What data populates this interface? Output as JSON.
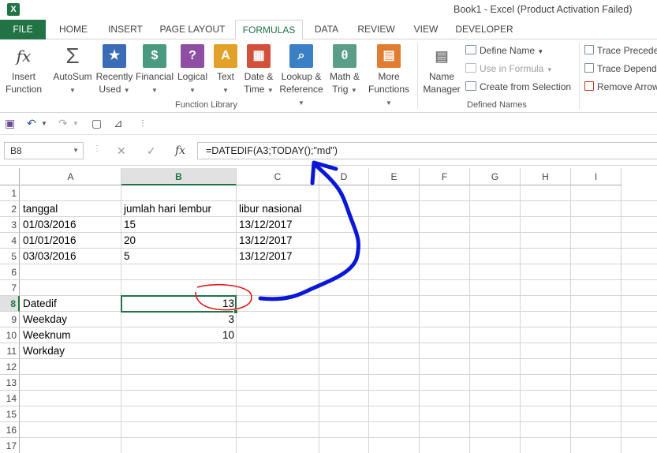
{
  "window": {
    "title": "Book1 - Excel (Product Activation Failed)",
    "app_icon": "X"
  },
  "tabs": [
    {
      "label": "FILE"
    },
    {
      "label": "HOME"
    },
    {
      "label": "INSERT"
    },
    {
      "label": "PAGE LAYOUT"
    },
    {
      "label": "FORMULAS"
    },
    {
      "label": "DATA"
    },
    {
      "label": "REVIEW"
    },
    {
      "label": "VIEW"
    },
    {
      "label": "DEVELOPER"
    }
  ],
  "ribbon": {
    "function_library": {
      "group_label": "Function Library",
      "buttons": [
        {
          "line1": "Insert",
          "line2": "Function",
          "icon": "fx"
        },
        {
          "line1": "AutoSum",
          "line2": "",
          "icon": "Σ"
        },
        {
          "line1": "Recently",
          "line2": "Used",
          "icon": "★"
        },
        {
          "line1": "Financial",
          "line2": "",
          "icon": "$"
        },
        {
          "line1": "Logical",
          "line2": "",
          "icon": "?"
        },
        {
          "line1": "Text",
          "line2": "",
          "icon": "A"
        },
        {
          "line1": "Date &",
          "line2": "Time",
          "icon": "▦"
        },
        {
          "line1": "Lookup &",
          "line2": "Reference",
          "icon": "⌕"
        },
        {
          "line1": "Math &",
          "line2": "Trig",
          "icon": "θ"
        },
        {
          "line1": "More",
          "line2": "Functions",
          "icon": "▤"
        }
      ]
    },
    "defined_names": {
      "group_label": "Defined Names",
      "name_manager": {
        "line1": "Name",
        "line2": "Manager"
      },
      "define_name": "Define Name",
      "use_in_formula": "Use in Formula",
      "create_from_selection": "Create from Selection"
    },
    "formula_auditing": {
      "trace_precedents": "Trace Precede",
      "trace_dependents": "Trace Depende",
      "remove_arrows": "Remove Arrow"
    }
  },
  "formula_bar": {
    "name_box": "B8",
    "fx_label": "fx",
    "formula": "=DATEDIF(A3;TODAY();\"md\")"
  },
  "sheet": {
    "columns": [
      "A",
      "B",
      "C",
      "D",
      "E",
      "F",
      "G",
      "H",
      "I"
    ],
    "selected_column": "B",
    "selected_row": 8,
    "rows": [
      {
        "n": 1,
        "A": "",
        "B": "",
        "C": ""
      },
      {
        "n": 2,
        "A": "tanggal",
        "B": "jumlah hari lembur",
        "C": "libur nasional"
      },
      {
        "n": 3,
        "A": "01/03/2016",
        "B": "15",
        "C": "13/12/2017"
      },
      {
        "n": 4,
        "A": "01/01/2016",
        "B": "20",
        "C": "13/12/2017"
      },
      {
        "n": 5,
        "A": "03/03/2016",
        "B": "5",
        "C": "13/12/2017"
      },
      {
        "n": 6,
        "A": "",
        "B": "",
        "C": ""
      },
      {
        "n": 7,
        "A": "",
        "B": "",
        "C": ""
      },
      {
        "n": 8,
        "A": "Datedif",
        "B": "13",
        "B_num": true,
        "C": ""
      },
      {
        "n": 9,
        "A": "Weekday",
        "B": "3",
        "B_num": true,
        "C": ""
      },
      {
        "n": 10,
        "A": "Weeknum",
        "B": "10",
        "B_num": true,
        "C": ""
      },
      {
        "n": 11,
        "A": "Workday",
        "B": "",
        "C": ""
      },
      {
        "n": 12,
        "A": "",
        "B": "",
        "C": ""
      },
      {
        "n": 13,
        "A": "",
        "B": "",
        "C": ""
      },
      {
        "n": 14,
        "A": "",
        "B": "",
        "C": ""
      },
      {
        "n": 15,
        "A": "",
        "B": "",
        "C": ""
      },
      {
        "n": 16,
        "A": "",
        "B": "",
        "C": ""
      },
      {
        "n": 17,
        "A": "",
        "B": "",
        "C": ""
      }
    ]
  },
  "colors": {
    "accent": "#217346",
    "annotation_blue": "#0a18d6",
    "annotation_red": "#e01b1b"
  }
}
